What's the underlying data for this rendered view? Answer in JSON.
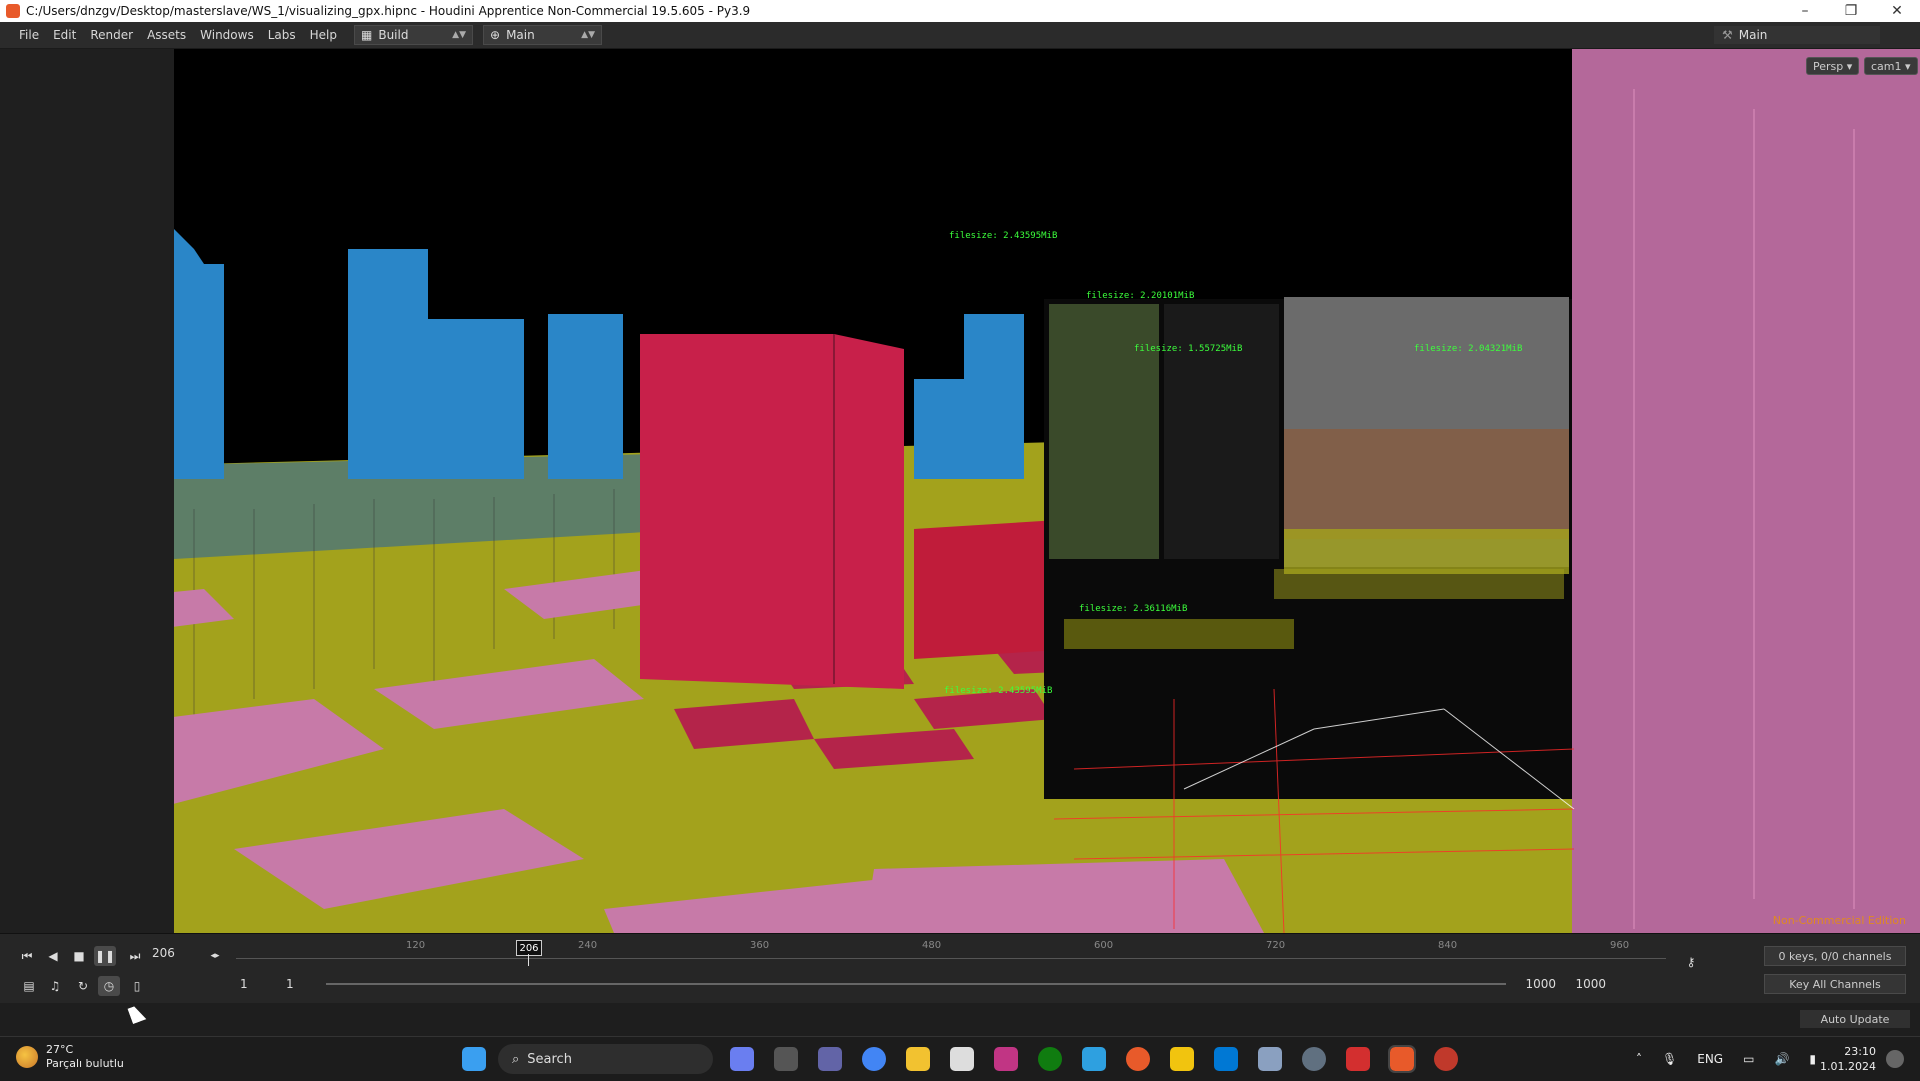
{
  "window": {
    "title": "C:/Users/dnzgv/Desktop/masterslave/WS_1/visualizing_gpx.hipnc - Houdini Apprentice Non-Commercial 19.5.605 - Py3.9",
    "minimize": "–",
    "maximize": "❐",
    "close": "✕"
  },
  "menu": {
    "items": [
      "File",
      "Edit",
      "Render",
      "Assets",
      "Windows",
      "Labs",
      "Help"
    ],
    "desktop_label": "Build",
    "context_label": "Main",
    "right_desktop": "Main"
  },
  "viewport": {
    "persp": "Persp ▾",
    "cam": "cam1 ▾",
    "watermark": "Non-Commercial Edition"
  },
  "overlay_labels": {
    "filesize_1": "filesize: 2.43595MiB",
    "filesize_2": "filesize: 2.20101MiB",
    "filesize_3": "filesize: 1.55725MiB",
    "filesize_4": "filesize: 2.04321MiB",
    "filesize_5": "filesize: 2.43595MiB",
    "filesize_6": "filesize: 2.36116MiB"
  },
  "playbar": {
    "current_frame": "206",
    "frame_marker": "206",
    "ticks": [
      "120",
      "240",
      "360",
      "480",
      "600",
      "720",
      "840",
      "960"
    ],
    "range_start": "1",
    "range_start2": "1",
    "range_end": "1000",
    "range_end2": "1000",
    "keys_info": "0 keys, 0/0 channels",
    "key_all": "Key All Channels",
    "auto_update": "Auto Update"
  },
  "taskbar": {
    "temperature": "27°C",
    "weather_desc": "Parçalı bulutlu",
    "search": "Search",
    "lang": "ENG",
    "time": "23:10",
    "date": "1.01.2024"
  },
  "colors": {
    "ground": "#a3a21c",
    "red_box": "#c8204a",
    "buildings": "#2a86c8",
    "pink_panels": "#c77aa8"
  }
}
